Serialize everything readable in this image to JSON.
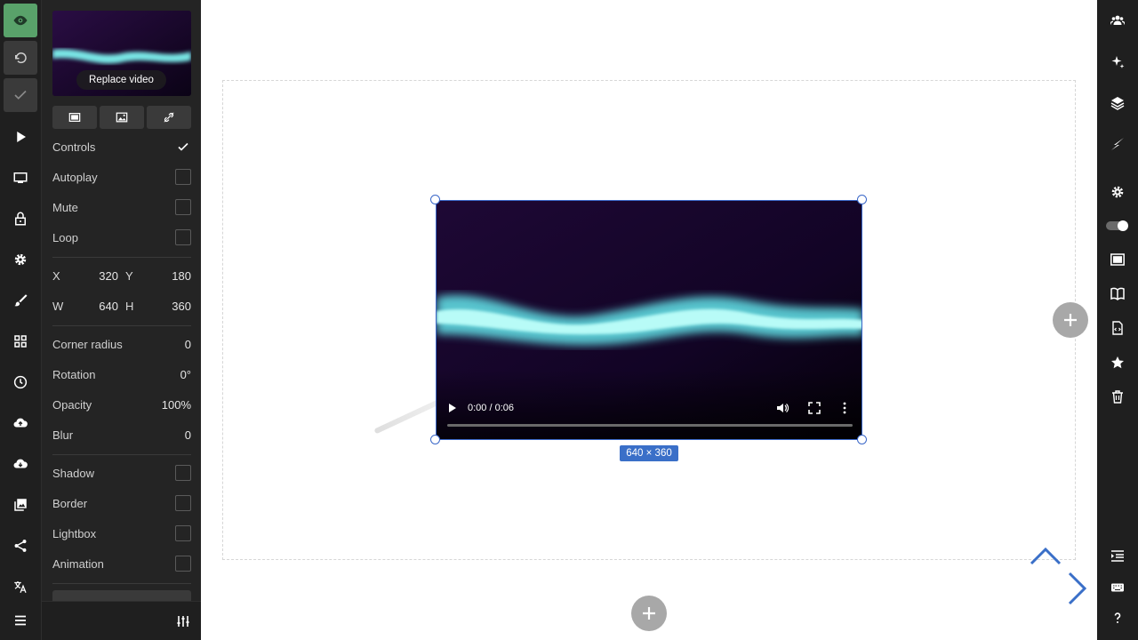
{
  "panel": {
    "replace_label": "Replace video",
    "toggles": [
      {
        "label": "Controls",
        "checked": true
      },
      {
        "label": "Autoplay",
        "checked": false
      },
      {
        "label": "Mute",
        "checked": false
      },
      {
        "label": "Loop",
        "checked": false
      }
    ],
    "geometry": {
      "x_label": "X",
      "x_value": "320",
      "y_label": "Y",
      "y_value": "180",
      "w_label": "W",
      "w_value": "640",
      "h_label": "H",
      "h_value": "360"
    },
    "props": [
      {
        "label": "Corner radius",
        "value": "0"
      },
      {
        "label": "Rotation",
        "value": "0°"
      },
      {
        "label": "Opacity",
        "value": "100%"
      },
      {
        "label": "Blur",
        "value": "0"
      }
    ],
    "effects": [
      {
        "label": "Shadow",
        "checked": false
      },
      {
        "label": "Border",
        "checked": false
      },
      {
        "label": "Lightbox",
        "checked": false
      },
      {
        "label": "Animation",
        "checked": false
      }
    ]
  },
  "video": {
    "time": "0:00 / 0:06",
    "progress": 0.0,
    "size_badge": "640 × 360"
  },
  "colors": {
    "accent_green": "#59a26a",
    "selection_blue": "#3a67c8",
    "particle_cyan": "#7ff3f0"
  }
}
